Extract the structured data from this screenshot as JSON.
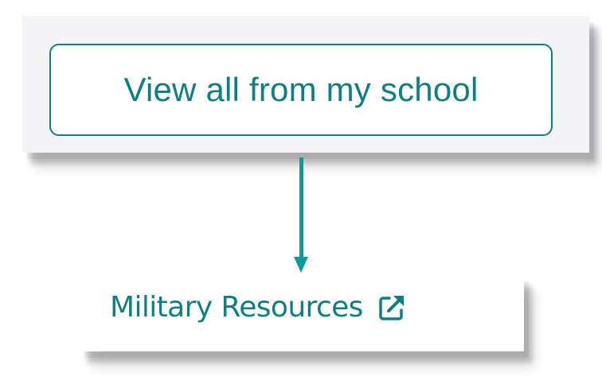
{
  "top_card": {
    "button_label": "View all from my school"
  },
  "bottom_card": {
    "link_label": "Military Resources",
    "link_icon": "external-link-icon"
  },
  "colors": {
    "accent": "#0e7f85",
    "arrow": "#0f9a9a",
    "top_card_bg": "#f4f4f8"
  }
}
